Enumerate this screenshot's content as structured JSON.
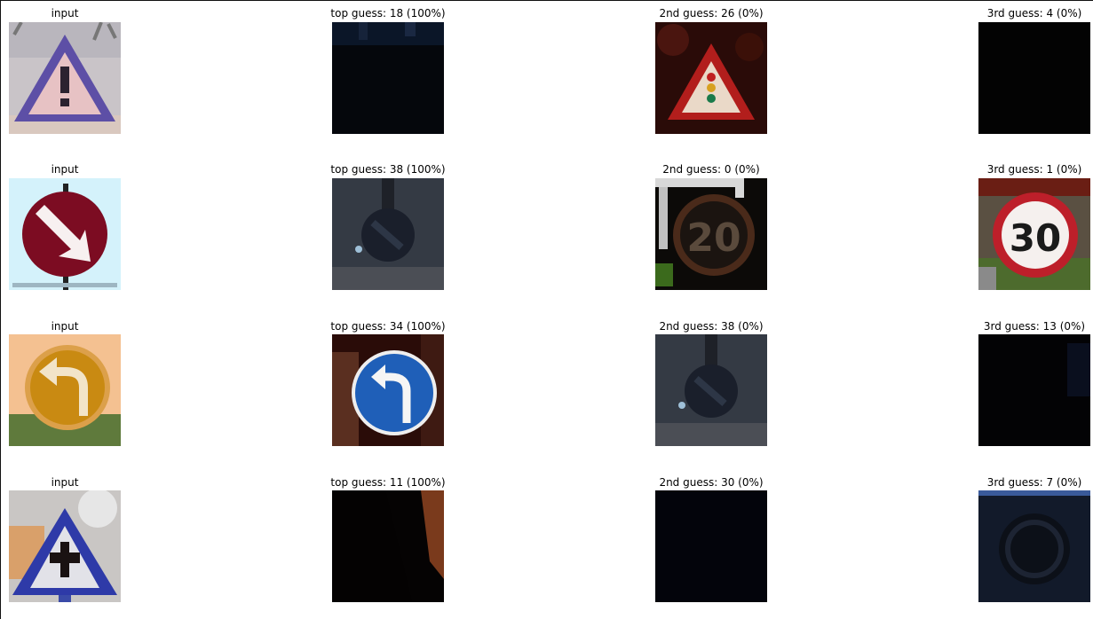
{
  "figure": {
    "rows": [
      {
        "cells": [
          {
            "title": "input",
            "content": "warning-triangle-exclamation-sign"
          },
          {
            "title": "top guess: 18 (100%)",
            "content": "dark-sample-image"
          },
          {
            "title": "2nd guess: 26 (0%)",
            "content": "traffic-signals-warning-sign"
          },
          {
            "title": "3rd guess: 4 (0%)",
            "content": "dark-sample-image"
          }
        ]
      },
      {
        "cells": [
          {
            "title": "input",
            "content": "keep-right-arrow-sign"
          },
          {
            "title": "top guess: 38 (100%)",
            "content": "dark-blurry-keep-right-sign"
          },
          {
            "title": "2nd guess: 0 (0%)",
            "content": "speed-limit-20-sign"
          },
          {
            "title": "3rd guess: 1 (0%)",
            "content": "speed-limit-30-sign"
          }
        ]
      },
      {
        "cells": [
          {
            "title": "input",
            "content": "orange-turn-left-sign"
          },
          {
            "title": "top guess: 34 (100%)",
            "content": "blue-turn-left-sign"
          },
          {
            "title": "2nd guess: 38 (0%)",
            "content": "dark-blurry-keep-right-sign"
          },
          {
            "title": "3rd guess: 13 (0%)",
            "content": "dark-sample-image"
          }
        ]
      },
      {
        "cells": [
          {
            "title": "input",
            "content": "priority-crossing-triangle-sign"
          },
          {
            "title": "top guess: 11 (100%)",
            "content": "dark-sample-with-red-edge"
          },
          {
            "title": "2nd guess: 30 (0%)",
            "content": "dark-sample-image"
          },
          {
            "title": "3rd guess: 7 (0%)",
            "content": "dark-round-sign-sample"
          }
        ]
      }
    ]
  },
  "text_overlays": {
    "speed_20": "20",
    "speed_30": "30"
  }
}
